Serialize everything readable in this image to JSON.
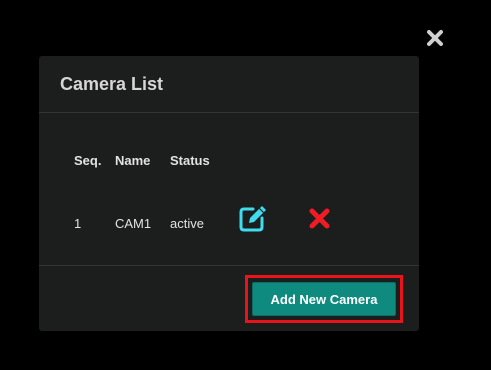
{
  "modal": {
    "title": "Camera List",
    "close_icon": "close-icon"
  },
  "table": {
    "headers": [
      "Seq.",
      "Name",
      "Status"
    ],
    "rows": [
      {
        "seq": "1",
        "name": "CAM1",
        "status": "active",
        "edit_icon": "edit-icon",
        "delete_icon": "delete-icon"
      }
    ]
  },
  "footer": {
    "add_button_label": "Add New Camera"
  },
  "colors": {
    "background": "#000000",
    "modal": "#1c1d1d",
    "accent_button": "#0f8a7e",
    "edit_icon": "#3fdcf0",
    "delete_icon": "#ee1c25",
    "highlight": "#e8141c"
  }
}
